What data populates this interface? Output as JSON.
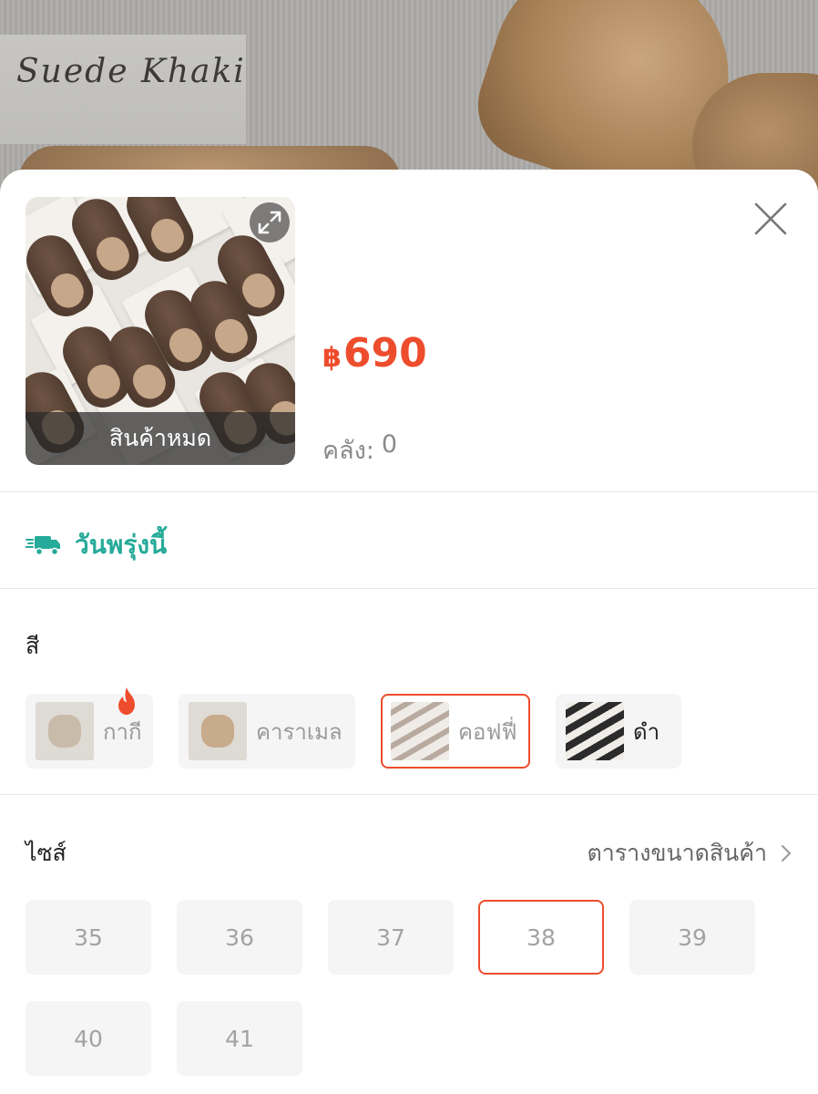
{
  "hero": {
    "overlay_text": "Suede Khaki"
  },
  "product": {
    "price_currency": "฿",
    "price_value": "690",
    "stock_label": "คลัง:",
    "stock_value": "0",
    "soldout_label": "สินค้าหมด"
  },
  "shipping": {
    "label": "วันพรุ่งนี้",
    "color": "#26aa99"
  },
  "color_section": {
    "label": "สี",
    "options": [
      {
        "label": "กากี",
        "state": "unavailable",
        "hot": true
      },
      {
        "label": "คาราเมล",
        "state": "unavailable",
        "hot": false
      },
      {
        "label": "คอฟฟี่",
        "state": "selected",
        "hot": false
      },
      {
        "label": "ดำ",
        "state": "available",
        "hot": false
      }
    ]
  },
  "size_section": {
    "label": "ไซส์",
    "size_chart_link": "ตารางขนาดสินค้า",
    "sizes": [
      "35",
      "36",
      "37",
      "38",
      "39",
      "40",
      "41"
    ],
    "selected": "38"
  },
  "colors": {
    "accent": "#ee4d2d",
    "teal": "#26aa99"
  },
  "icons": [
    "expand-icon",
    "close-icon",
    "delivery-truck-icon",
    "fire-icon",
    "chevron-right-icon"
  ]
}
